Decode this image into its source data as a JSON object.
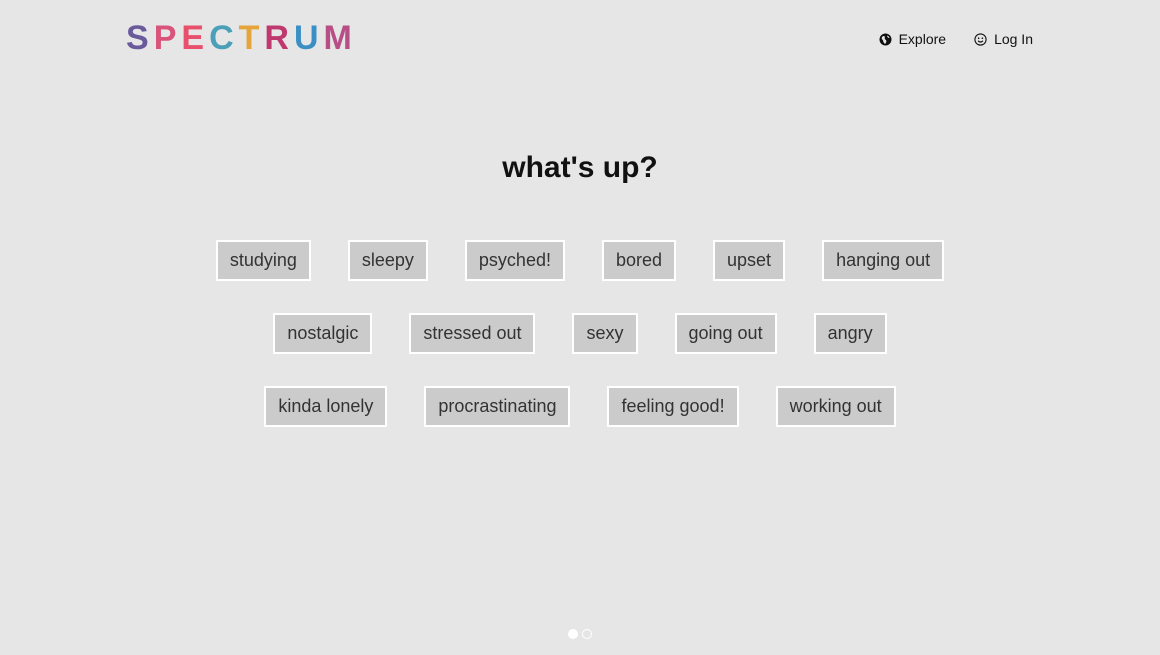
{
  "logo": {
    "letters": [
      {
        "char": "S",
        "color": "#6a5a9c"
      },
      {
        "char": "P",
        "color": "#d9537a"
      },
      {
        "char": "E",
        "color": "#e8506b"
      },
      {
        "char": "C",
        "color": "#4aa0b8"
      },
      {
        "char": "T",
        "color": "#e6a53a"
      },
      {
        "char": "R",
        "color": "#c0396e"
      },
      {
        "char": "U",
        "color": "#3a8fc4"
      },
      {
        "char": "M",
        "color": "#b74f86"
      }
    ]
  },
  "nav": {
    "explore_label": "Explore",
    "explore_icon": "globe-icon",
    "login_label": "Log In",
    "login_icon": "smiley-icon"
  },
  "headline": "what's up?",
  "moods": {
    "row1": [
      "studying",
      "sleepy",
      "psyched!",
      "bored",
      "upset",
      "hanging out"
    ],
    "row2": [
      "nostalgic",
      "stressed out",
      "sexy",
      "going out",
      "angry"
    ],
    "row3": [
      "kinda lonely",
      "procrastinating",
      "feeling good!",
      "working out"
    ]
  },
  "pager": {
    "pages": 2,
    "active_index": 0
  }
}
